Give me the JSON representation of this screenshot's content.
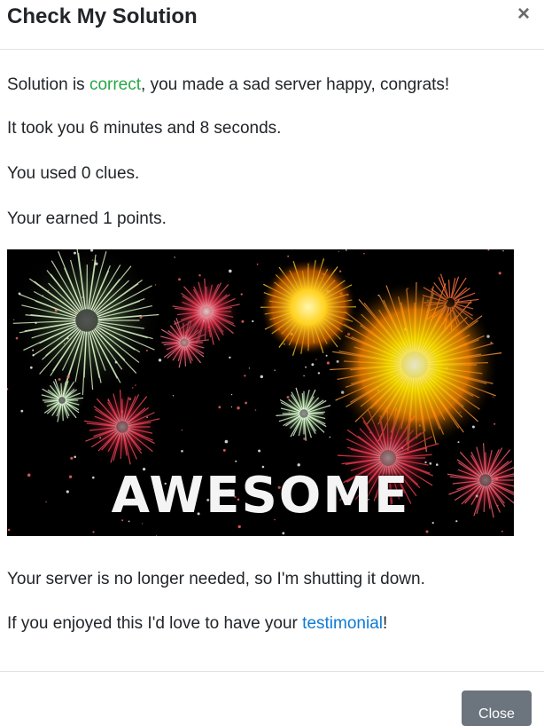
{
  "modal": {
    "title": "Check My Solution",
    "close_symbol": "×"
  },
  "body": {
    "line1_prefix": "Solution is ",
    "line1_status": "correct",
    "line1_suffix": ", you made a sad server happy, congrats!",
    "time_line": "It took you 6 minutes and 8 seconds.",
    "clues_line": "You used 0 clues.",
    "points_line": "Your earned 1 points.",
    "image_caption": "AWESOME",
    "shutdown_line": "Your server is no longer needed, so I'm shutting it down.",
    "testimonial_prefix": "If you enjoyed this I'd love to have your ",
    "testimonial_link": "testimonial",
    "testimonial_suffix": "!"
  },
  "footer": {
    "close_label": "Close"
  },
  "colors": {
    "correct": "#28a745",
    "link": "#0d7ad6",
    "button": "#6c757d"
  },
  "icons": [
    "close-icon"
  ]
}
